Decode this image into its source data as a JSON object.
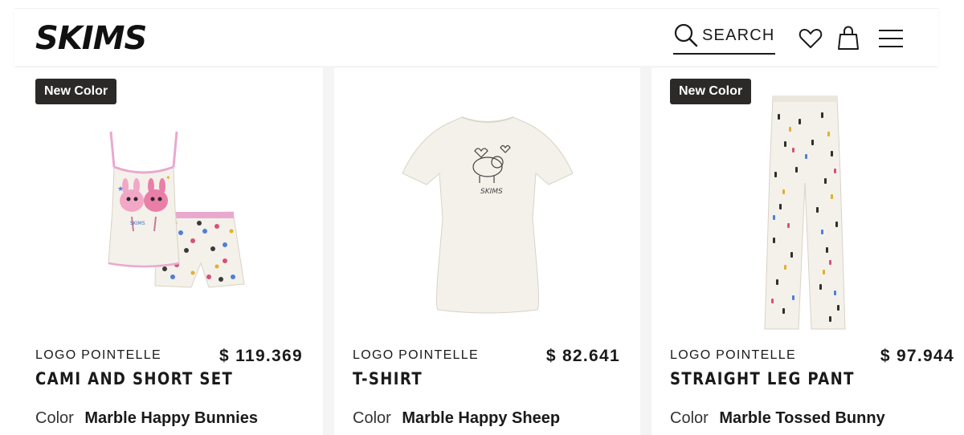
{
  "header": {
    "brand": "SKIMS",
    "search_label": "SEARCH",
    "icons": [
      "search-icon",
      "heart-icon",
      "bag-icon",
      "menu-icon"
    ]
  },
  "products": [
    {
      "badge": "New Color",
      "subtitle": "LOGO POINTELLE",
      "name": "CAMI AND SHORT SET",
      "price": "$ 119.369",
      "color_label": "Color",
      "color_value": "Marble Happy Bunnies"
    },
    {
      "badge": "",
      "subtitle": "LOGO POINTELLE",
      "name": "T-SHIRT",
      "price": "$ 82.641",
      "color_label": "Color",
      "color_value": "Marble Happy Sheep"
    },
    {
      "badge": "New Color",
      "subtitle": "LOGO POINTELLE",
      "name": "STRAIGHT LEG PANT",
      "price": "$ 97.944",
      "color_label": "Color",
      "color_value": "Marble Tossed Bunny"
    }
  ],
  "colors": {
    "text": "#1a1a1a",
    "badge_bg": "#2b2a29",
    "badge_text": "#ffffff",
    "divider": "#f4f4f4",
    "garment": "#f4f1ea",
    "trim_pink": "#e9a9cf"
  }
}
